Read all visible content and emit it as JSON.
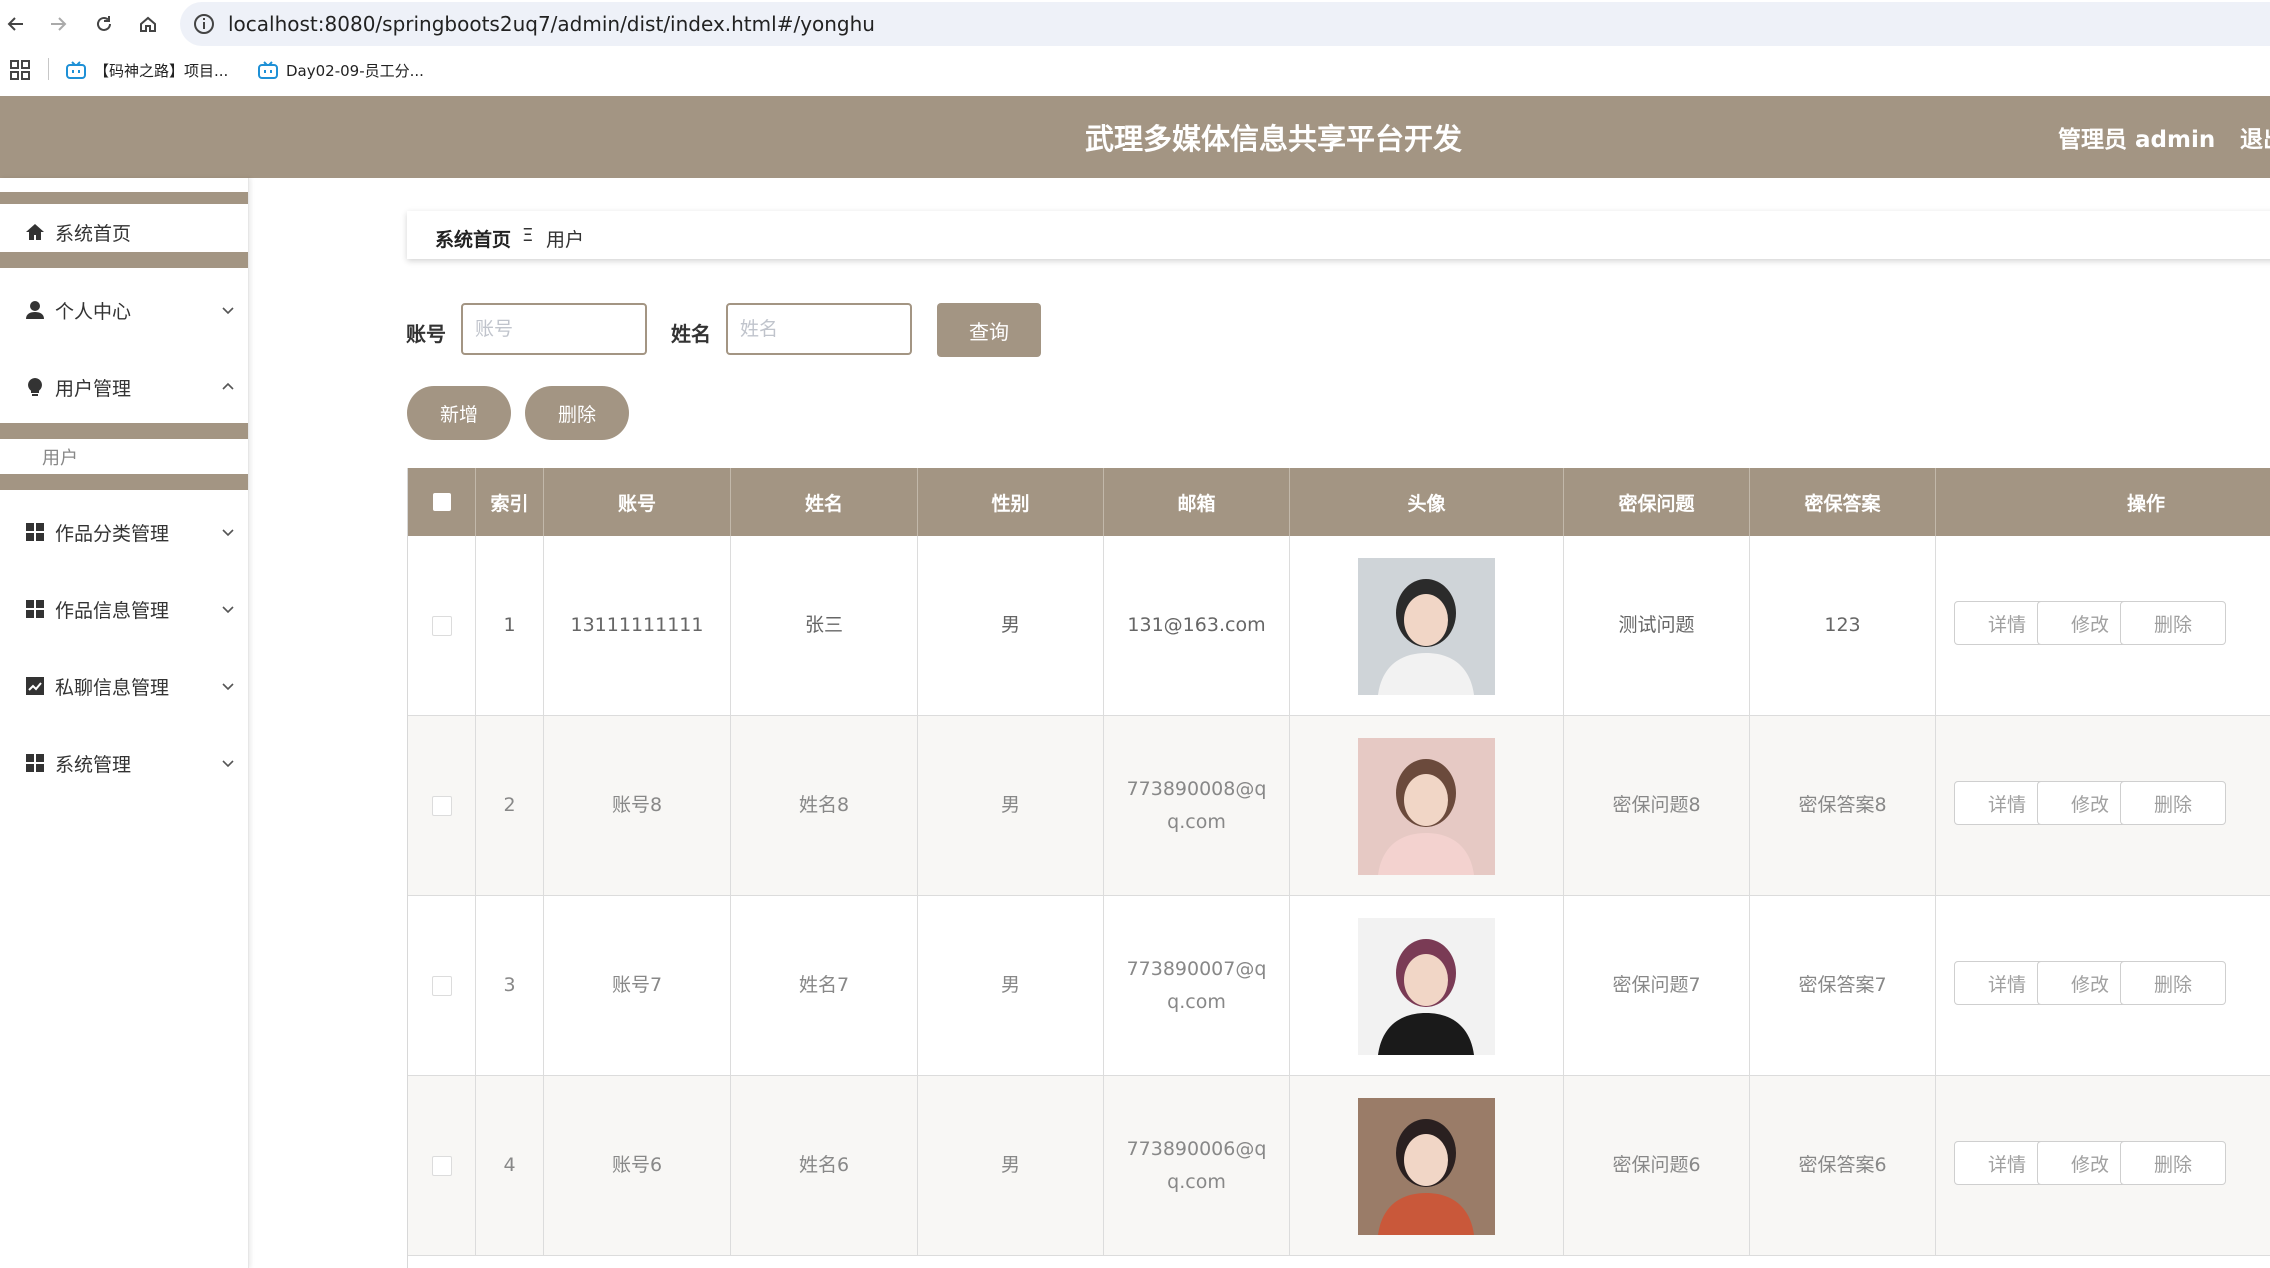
{
  "browser": {
    "url": "localhost:8080/springboots2uq7/admin/dist/index.html#/yonghu",
    "bookmarks": [
      "【码神之路】项目...",
      "Day02-09-员工分..."
    ]
  },
  "header": {
    "title": "武理多媒体信息共享平台开发",
    "user_label": "管理员 admin",
    "logout_label": "退出"
  },
  "sidebar": {
    "items": [
      {
        "label": "系统首页",
        "icon": "home-icon"
      },
      {
        "label": "个人中心",
        "icon": "user-icon"
      },
      {
        "label": "用户管理",
        "icon": "bulb-icon",
        "sub": [
          "用户"
        ]
      },
      {
        "label": "作品分类管理",
        "icon": "grid-icon"
      },
      {
        "label": "作品信息管理",
        "icon": "grid-icon"
      },
      {
        "label": "私聊信息管理",
        "icon": "chart-icon"
      },
      {
        "label": "系统管理",
        "icon": "grid-icon"
      }
    ]
  },
  "breadcrumb": {
    "home": "系统首页",
    "separator": "Ξ",
    "current": "用户"
  },
  "search": {
    "account_label": "账号",
    "account_placeholder": "账号",
    "name_label": "姓名",
    "name_placeholder": "姓名",
    "query_button": "查询"
  },
  "actions": {
    "add": "新增",
    "delete": "删除"
  },
  "table": {
    "headers": [
      "索引",
      "账号",
      "姓名",
      "性别",
      "邮箱",
      "头像",
      "密保问题",
      "密保答案",
      "操作"
    ],
    "rows": [
      {
        "index": "1",
        "account": "13111111111",
        "name": "张三",
        "gender": "男",
        "email": "131@163.com",
        "question": "测试问题",
        "answer": "123"
      },
      {
        "index": "2",
        "account": "账号8",
        "name": "姓名8",
        "gender": "男",
        "email": "773890008@qq.com",
        "question": "密保问题8",
        "answer": "密保答案8"
      },
      {
        "index": "3",
        "account": "账号7",
        "name": "姓名7",
        "gender": "男",
        "email": "773890007@qq.com",
        "question": "密保问题7",
        "answer": "密保答案7"
      },
      {
        "index": "4",
        "account": "账号6",
        "name": "姓名6",
        "gender": "男",
        "email": "773890006@qq.com",
        "question": "密保问题6",
        "answer": "密保答案6"
      }
    ],
    "row_buttons": {
      "detail": "详情",
      "edit": "修改",
      "delete": "删除"
    }
  },
  "colors": {
    "accent": "#a39583",
    "row_alt": "#f8f7f5"
  }
}
